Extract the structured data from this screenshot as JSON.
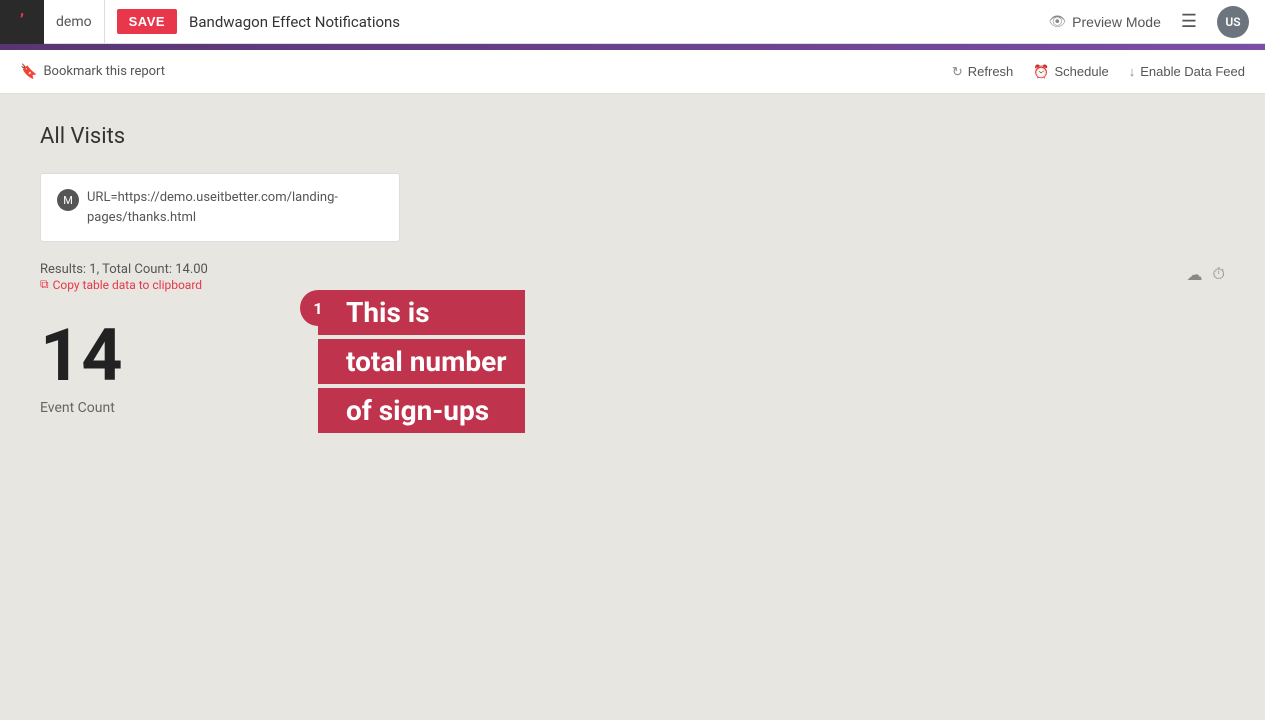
{
  "app": {
    "logo_text": "ʼ",
    "workspace_label": "demo",
    "save_button_label": "SAVE",
    "report_title": "Bandwagon Effect Notifications",
    "preview_mode_label": "Preview Mode",
    "menu_icon": "☰",
    "user_initials": "US"
  },
  "toolbar": {
    "bookmark_label": "Bookmark this report",
    "refresh_label": "Refresh",
    "schedule_label": "Schedule",
    "enable_data_feed_label": "Enable Data Feed"
  },
  "main": {
    "page_title": "All Visits",
    "filter": {
      "badge": "M",
      "url_label": "URL=https://demo.useitbetter.com/landing-pages/thanks.html"
    },
    "results": {
      "text": "Results: 1, Total Count: 14.00",
      "copy_label": "Copy table data to clipboard"
    },
    "metric": {
      "value": "14",
      "label": "Event Count"
    },
    "annotation": {
      "badge_number": "1",
      "line1": "This is",
      "line2": "total number",
      "line3": "of sign-ups"
    }
  },
  "colors": {
    "accent": "#e8374a",
    "annotation_bg": "#c0334d",
    "purple_bar": "#6a3d8f"
  }
}
